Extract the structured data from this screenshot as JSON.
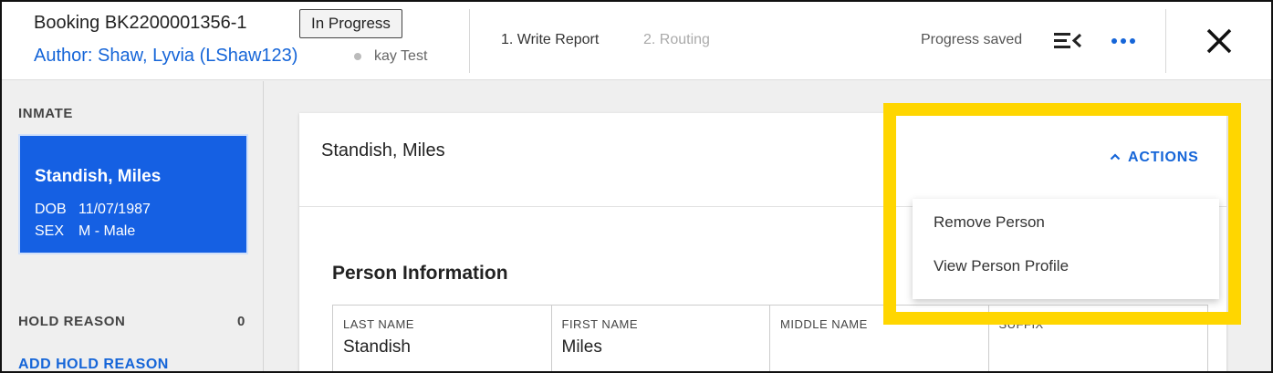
{
  "header": {
    "booking_title": "Booking BK2200001356-1",
    "status": "In Progress",
    "author": "Author: Shaw, Lyvia (LShaw123)",
    "sub_user": "kay Test",
    "steps": [
      {
        "label": "1. Write Report",
        "state": "active"
      },
      {
        "label": "2. Routing",
        "state": "inactive"
      }
    ],
    "progress_text": "Progress saved",
    "icons": [
      "collapse-list-icon",
      "more-options-icon",
      "close-icon"
    ],
    "accent_color": "#1565d8"
  },
  "sidebar": {
    "inmate_heading": "INMATE",
    "inmate": {
      "name": "Standish, Miles",
      "dob_label": "DOB",
      "dob": "11/07/1987",
      "sex_label": "SEX",
      "sex": "M - Male"
    },
    "hold_reason_heading": "HOLD REASON",
    "hold_reason_count": "0",
    "add_hold_reason": "ADD HOLD REASON"
  },
  "main": {
    "card_title": "Standish, Miles",
    "actions_label": "ACTIONS",
    "actions_menu": [
      "Remove Person",
      "View Person Profile"
    ],
    "section_title": "Person Information",
    "fields": [
      {
        "label": "LAST NAME",
        "value": "Standish"
      },
      {
        "label": "FIRST NAME",
        "value": "Miles"
      },
      {
        "label": "MIDDLE NAME",
        "value": ""
      },
      {
        "label": "SUFFIX",
        "value": ""
      }
    ]
  },
  "highlight_color": "#ffd600"
}
